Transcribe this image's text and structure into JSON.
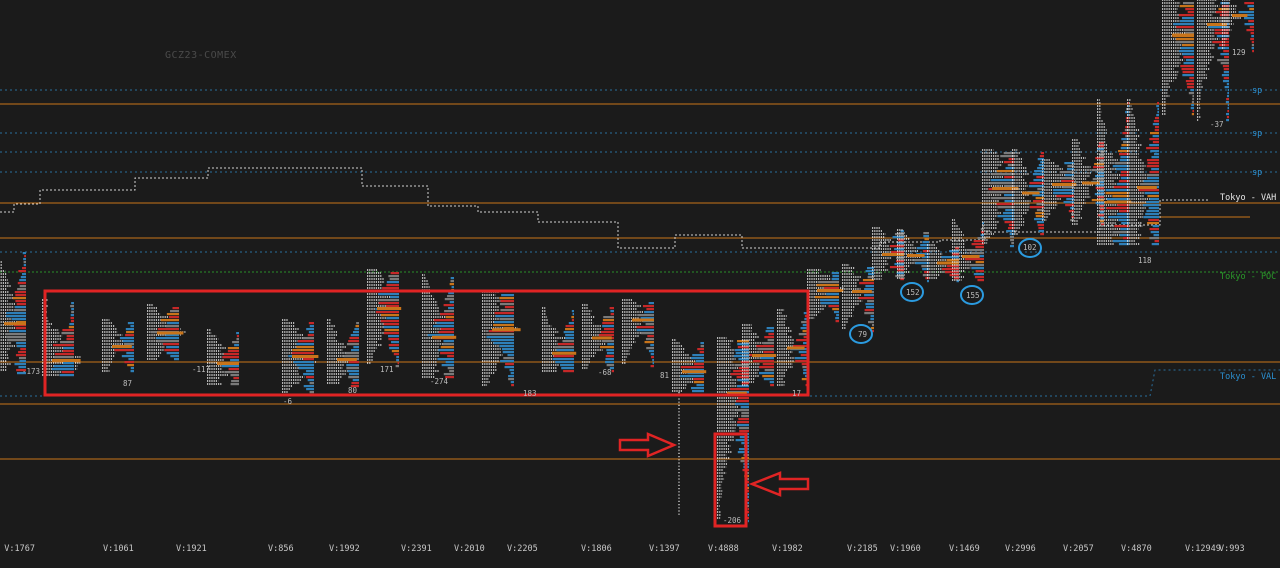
{
  "symbol": "GCZ23-COMEX",
  "colors": {
    "background": "#1b1b1b",
    "orange_line": "#c8741a",
    "blue_dashed": "#2a6f9e",
    "white_dotted": "#d0d0d0",
    "ask_volume": "#2e7fb8",
    "bid_volume": "#c62828",
    "tpo": "#e8e8e8",
    "highlight_box": "#e02424",
    "circle": "#2b9be0",
    "poc_green": "#2a8f2a"
  },
  "levels": [
    {
      "label": "sp",
      "color": "#2b8fd0"
    },
    {
      "label": "sp",
      "color": "#2b8fd0"
    },
    {
      "label": "sp",
      "color": "#2b8fd0"
    },
    {
      "label": "Tokyo - VAH",
      "color": "#e8e8e8"
    },
    {
      "label": "Tokyo - POC",
      "color": "#2a9a2a"
    },
    {
      "label": "Tokyo - VAL",
      "color": "#2b8fd0"
    }
  ],
  "chart_data": {
    "type": "volume-profile",
    "title": "GCZ23-COMEX",
    "volume_labels": [
      "3 V:1767",
      "V:1061",
      "V:1921",
      "V:856",
      "V:1992",
      "V:2391",
      "V:2010",
      "V:2205",
      "V:1806",
      "V:1397",
      "V:4888",
      "V:1982",
      "V:2185",
      "V:1960",
      "V:1469",
      "V:2996",
      "V:2057",
      "V:4870",
      "V:12949",
      "V:993"
    ],
    "delta_labels": [
      "-173",
      "87",
      "-117",
      "-6",
      "80",
      "171",
      "-274",
      "183",
      "-68",
      "81",
      "-206",
      "17",
      "79",
      "152",
      "155",
      "102",
      "118",
      "-37",
      "129"
    ],
    "circled_deltas": [
      "79",
      "152",
      "155",
      "102"
    ],
    "boxed_delta": "-206",
    "annotations": [
      "consolidation-range-box",
      "arrow-to-long-tail",
      "arrow-to-delta-box"
    ]
  }
}
